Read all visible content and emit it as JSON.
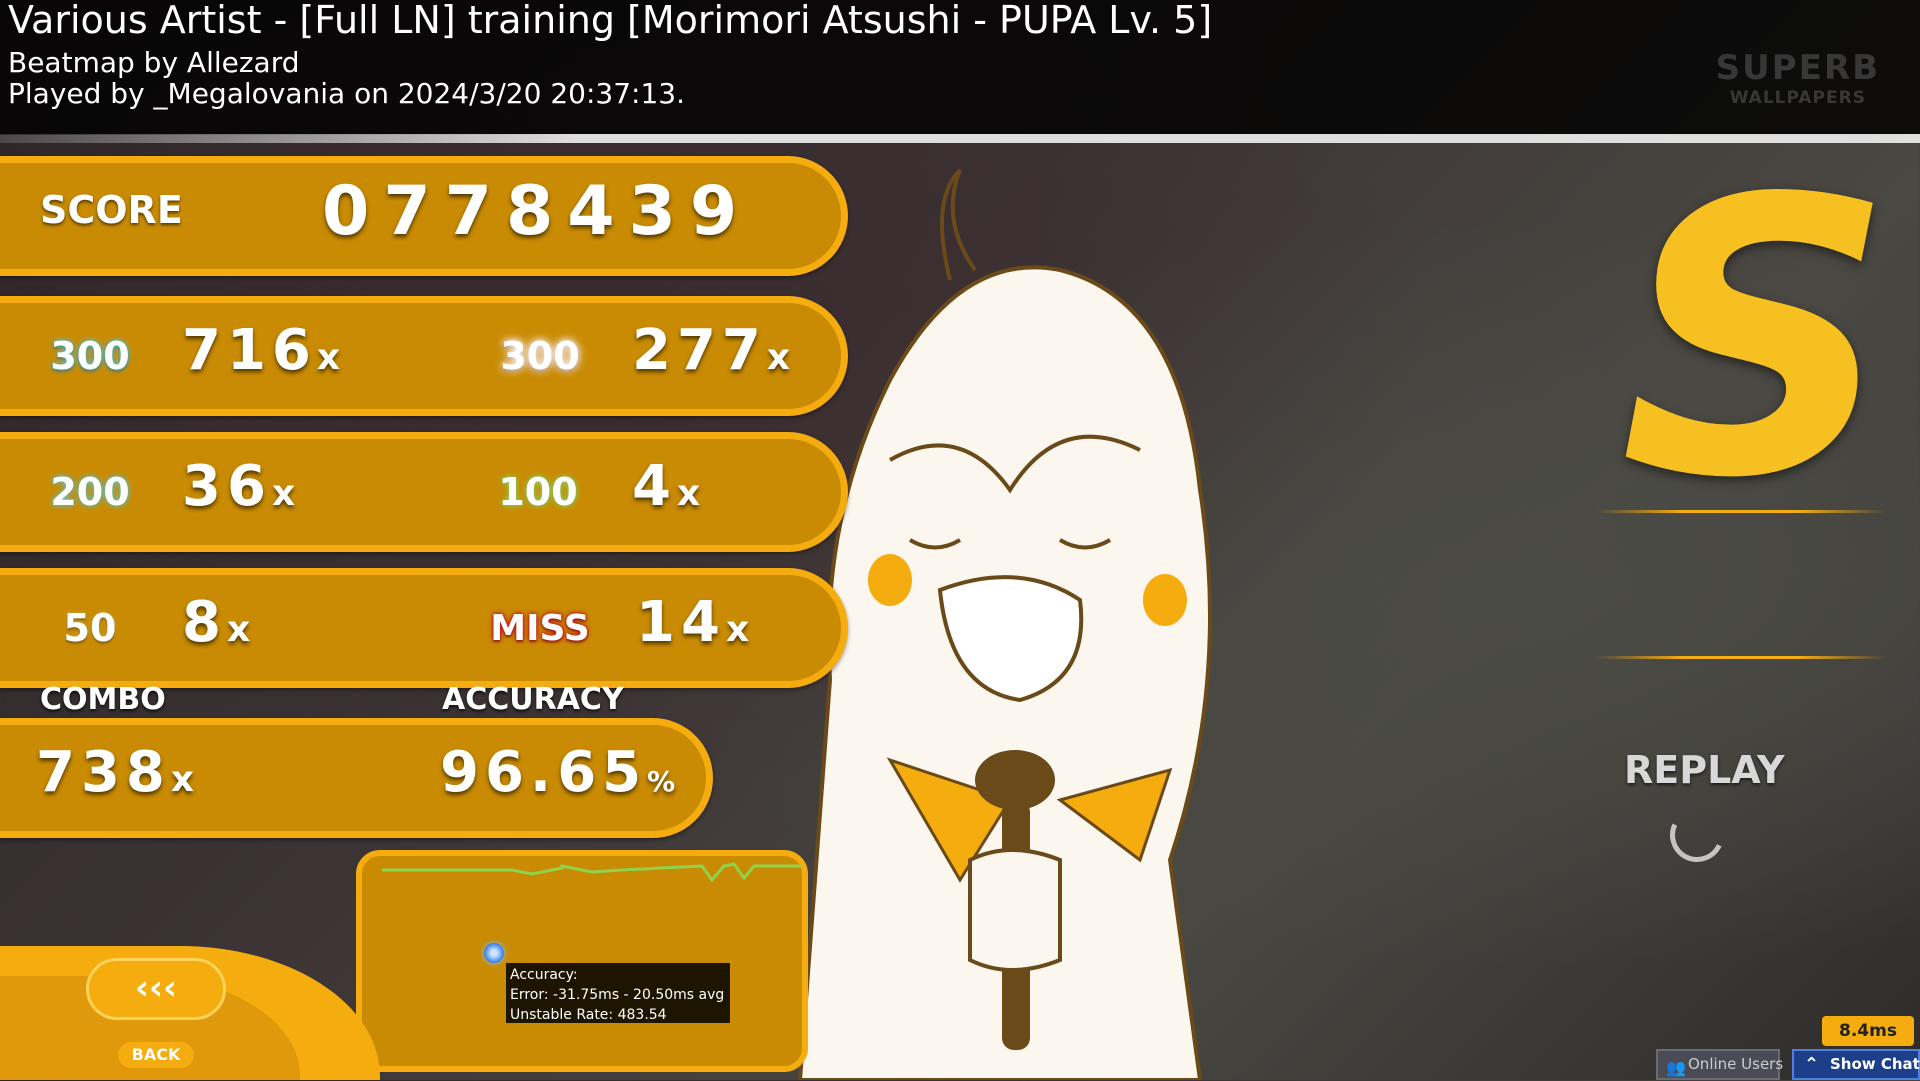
{
  "header": {
    "title": "Various Artist - [Full LN] training [Morimori Atsushi - PUPA Lv. 5]",
    "beatmap_by": "Beatmap by Allezard",
    "played_by": "Played by _Megalovania on 2024/3/20 20:37:13."
  },
  "watermark": {
    "line1": "SUPERB",
    "line2": "WALLPAPERS"
  },
  "score": {
    "label": "SCORE",
    "value": "0778439"
  },
  "judgements": {
    "j300": {
      "label": "300",
      "count": "716",
      "unit": "x"
    },
    "j300g": {
      "label": "300",
      "count": "277",
      "unit": "x"
    },
    "j200": {
      "label": "200",
      "count": "36",
      "unit": "x"
    },
    "j100": {
      "label": "100",
      "count": "4",
      "unit": "x"
    },
    "j50": {
      "label": "50",
      "count": "8",
      "unit": "x"
    },
    "miss": {
      "label": "MISS",
      "count": "14",
      "unit": "x"
    }
  },
  "combo": {
    "label": "COMBO",
    "value": "738",
    "unit": "x"
  },
  "accuracy": {
    "label": "ACCURACY",
    "value": "96.65",
    "unit": "%"
  },
  "graph_tooltip": {
    "line1": "Accuracy:",
    "line2": "Error: -31.75ms - 20.50ms avg",
    "line3": "Unstable Rate: 483.54"
  },
  "back": {
    "icon_text": "‹‹‹",
    "label": "BACK"
  },
  "rank": "S",
  "replay": "REPLAY",
  "latency": "8.4ms",
  "bottom_buttons": {
    "online_users": "Online Users",
    "show_chat": "Show Chat"
  },
  "colors": {
    "accent": "#f5ac0f",
    "panel": "#c98b04",
    "rank": "#f5c020"
  }
}
